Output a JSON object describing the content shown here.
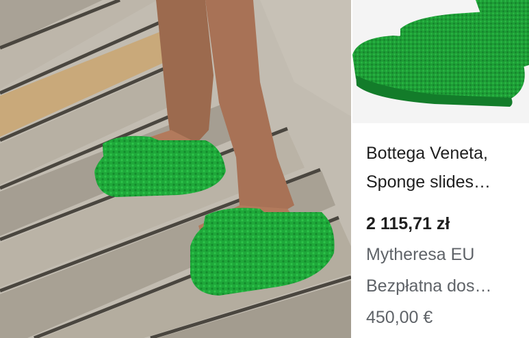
{
  "product": {
    "title_line1": "Bottega Veneta,",
    "title_line2": "Sponge slides…",
    "price": "2 115,71 zł",
    "seller": "Mytheresa EU",
    "shipping": "Bezpłatna dos…",
    "secondary_price": "450,00 €"
  },
  "images": {
    "main_photo": "green-terry-slides-on-boardwalk-photo",
    "thumbnail": "green-terry-slides-product-photo"
  },
  "colors": {
    "slide_green": "#1fa83a",
    "price_text": "#1f1f1f",
    "muted_text": "#5f6368"
  }
}
